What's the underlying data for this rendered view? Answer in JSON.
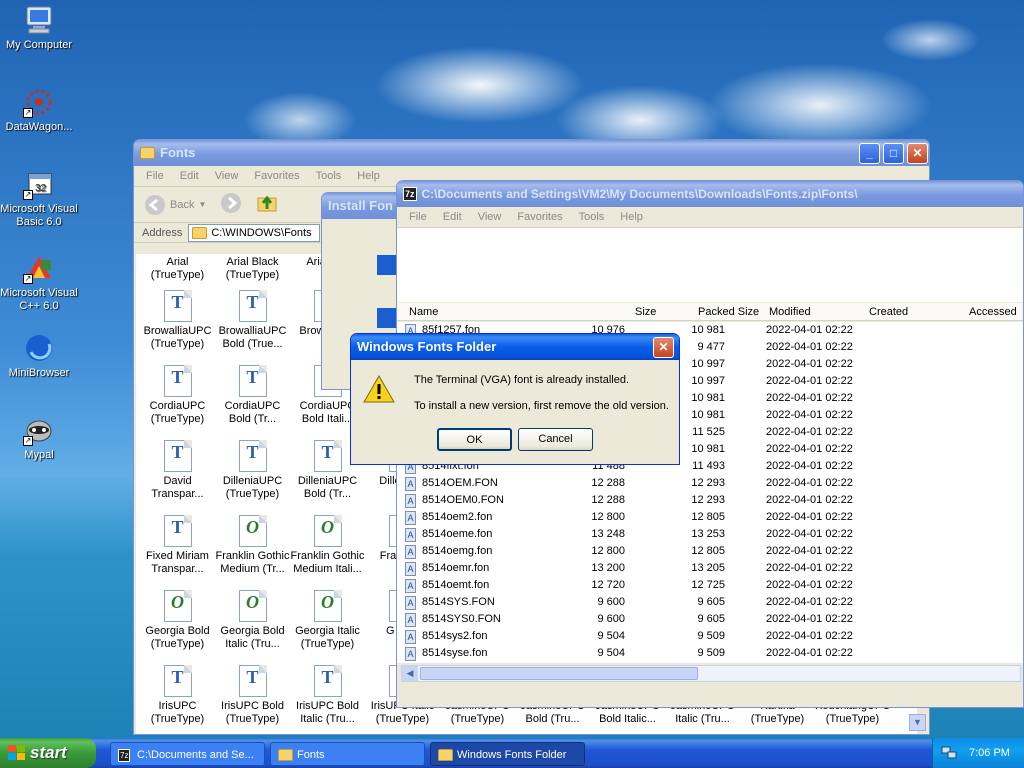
{
  "desktop": {
    "icons": [
      {
        "label": "My Computer",
        "icon": "my-computer-icon"
      },
      {
        "label": "DataWagon...",
        "icon": "datawagon-icon"
      },
      {
        "label": "Microsoft Visual Basic 6.0",
        "icon": "visual-basic-icon"
      },
      {
        "label": "Microsoft Visual C++ 6.0",
        "icon": "visual-cpp-icon"
      },
      {
        "label": "MiniBrowser",
        "icon": "minibrowser-icon"
      },
      {
        "label": "Mypal",
        "icon": "mypal-icon"
      }
    ]
  },
  "fonts_window": {
    "title": "Fonts",
    "menu": [
      "File",
      "Edit",
      "View",
      "Favorites",
      "Tools",
      "Help"
    ],
    "back_label": "Back",
    "address_label": "Address",
    "address_value": "C:\\WINDOWS\\Fonts",
    "items": [
      {
        "name": "Arial (TrueType)",
        "kind": "none"
      },
      {
        "name": "Arial Black (TrueType)",
        "kind": "none"
      },
      {
        "name": "Aria (Tru",
        "kind": "none"
      },
      {
        "name": "BrowalliaUPC (TrueType)",
        "kind": "tt"
      },
      {
        "name": "BrowalliaUPC Bold (True...",
        "kind": "tt"
      },
      {
        "name": "Brow Bold I",
        "kind": "tt"
      },
      {
        "name": "CordiaUPC (TrueType)",
        "kind": "tt"
      },
      {
        "name": "CordiaUPC Bold (Tr...",
        "kind": "tt"
      },
      {
        "name": "CordiaUPC Bold Itali...",
        "kind": "tt"
      },
      {
        "name": "David Transpar...",
        "kind": "tt"
      },
      {
        "name": "DilleniaUPC (TrueType)",
        "kind": "tt"
      },
      {
        "name": "DilleniaUPC Bold (Tr...",
        "kind": "tt"
      },
      {
        "name": "Dille Bold",
        "kind": "tt"
      },
      {
        "name": "Fixed Miriam Transpar...",
        "kind": "tt"
      },
      {
        "name": "Franklin Gothic Medium (Tr...",
        "kind": "ot"
      },
      {
        "name": "Franklin Gothic Medium Itali...",
        "kind": "ot"
      },
      {
        "name": "Fran (Tru",
        "kind": "ot"
      },
      {
        "name": "Georgia Bold (TrueType)",
        "kind": "ot"
      },
      {
        "name": "Georgia Bold Italic (Tru...",
        "kind": "ot"
      },
      {
        "name": "Georgia Italic (TrueType)",
        "kind": "ot"
      },
      {
        "name": "G Mon",
        "kind": "ot"
      },
      {
        "name": "IrisUPC (TrueType)",
        "kind": "tt"
      },
      {
        "name": "IrisUPC Bold (TrueType)",
        "kind": "tt"
      },
      {
        "name": "IrisUPC Bold Italic (Tru...",
        "kind": "tt"
      },
      {
        "name": "IrisUPC Italic (TrueType)",
        "kind": "tt"
      },
      {
        "name": "JasmineUPC (TrueType)",
        "kind": "tt"
      },
      {
        "name": "JasmineUPC Bold (Tru...",
        "kind": "tt"
      },
      {
        "name": "JasmineUPC Bold Italic...",
        "kind": "tt"
      },
      {
        "name": "JasmineUPC Italic (Tru...",
        "kind": "tt"
      },
      {
        "name": "Kartika (TrueType)",
        "kind": "tt"
      },
      {
        "name": "KodchiangUPC (TrueType)",
        "kind": "tt"
      }
    ]
  },
  "install_window": {
    "title": "Install Fon"
  },
  "zip_window": {
    "title": "C:\\Documents and Settings\\VM2\\My Documents\\Downloads\\Fonts.zip\\Fonts\\",
    "menu": [
      "File",
      "Edit",
      "View",
      "Favorites",
      "Tools",
      "Help"
    ],
    "columns": [
      "Name",
      "Size",
      "Packed Size",
      "Modified",
      "Created",
      "Accessed"
    ],
    "rows": [
      {
        "name": "85f1257.fon",
        "size": "10 976",
        "packed": "10 981",
        "modified": "2022-04-01 02:22"
      },
      {
        "name": "",
        "size": "",
        "packed": "9 477",
        "modified": "2022-04-01 02:22"
      },
      {
        "name": "",
        "size": "",
        "packed": "10 997",
        "modified": "2022-04-01 02:22"
      },
      {
        "name": "",
        "size": "",
        "packed": "10 997",
        "modified": "2022-04-01 02:22"
      },
      {
        "name": "",
        "size": "",
        "packed": "10 981",
        "modified": "2022-04-01 02:22"
      },
      {
        "name": "",
        "size": "",
        "packed": "10 981",
        "modified": "2022-04-01 02:22"
      },
      {
        "name": "",
        "size": "",
        "packed": "11 525",
        "modified": "2022-04-01 02:22"
      },
      {
        "name": "",
        "size": "",
        "packed": "10 981",
        "modified": "2022-04-01 02:22"
      },
      {
        "name": "8514fixt.fon",
        "size": "11 488",
        "packed": "11 493",
        "modified": "2022-04-01 02:22"
      },
      {
        "name": "8514OEM.FON",
        "size": "12 288",
        "packed": "12 293",
        "modified": "2022-04-01 02:22"
      },
      {
        "name": "8514OEM0.FON",
        "size": "12 288",
        "packed": "12 293",
        "modified": "2022-04-01 02:22"
      },
      {
        "name": "8514oem2.fon",
        "size": "12 800",
        "packed": "12 805",
        "modified": "2022-04-01 02:22"
      },
      {
        "name": "8514oeme.fon",
        "size": "13 248",
        "packed": "13 253",
        "modified": "2022-04-01 02:22"
      },
      {
        "name": "8514oemg.fon",
        "size": "12 800",
        "packed": "12 805",
        "modified": "2022-04-01 02:22"
      },
      {
        "name": "8514oemr.fon",
        "size": "13 200",
        "packed": "13 205",
        "modified": "2022-04-01 02:22"
      },
      {
        "name": "8514oemt.fon",
        "size": "12 720",
        "packed": "12 725",
        "modified": "2022-04-01 02:22"
      },
      {
        "name": "8514SYS.FON",
        "size": "9 600",
        "packed": "9 605",
        "modified": "2022-04-01 02:22"
      },
      {
        "name": "8514SYS0.FON",
        "size": "9 600",
        "packed": "9 605",
        "modified": "2022-04-01 02:22"
      },
      {
        "name": "8514sys2.fon",
        "size": "9 504",
        "packed": "9 509",
        "modified": "2022-04-01 02:22"
      },
      {
        "name": "8514syse.fon",
        "size": "9 504",
        "packed": "9 509",
        "modified": "2022-04-01 02:22"
      }
    ]
  },
  "dialog": {
    "title": "Windows Fonts Folder",
    "message1": "The Terminal (VGA) font is already installed.",
    "message2": "To install a new version, first remove the old version.",
    "ok_label": "OK",
    "cancel_label": "Cancel"
  },
  "taskbar": {
    "start_label": "start",
    "tasks": [
      {
        "label": "C:\\Documents and Se...",
        "icon": "seven-zip-icon"
      },
      {
        "label": "Fonts",
        "icon": "folder-icon"
      },
      {
        "label": "Windows Fonts Folder",
        "icon": "folder-icon"
      }
    ],
    "clock": "7:06 PM"
  },
  "colors": {
    "xp_blue": "#0a5fe8",
    "taskbar": "#245edb",
    "tray": "#0f8ae6",
    "start_green": "#3c9b3c"
  }
}
